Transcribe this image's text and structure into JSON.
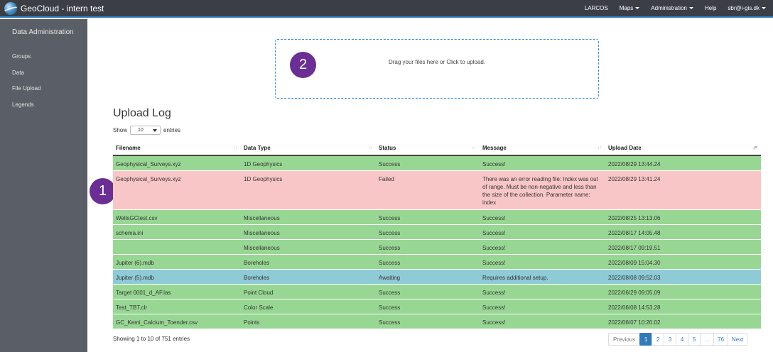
{
  "app": {
    "title": "GeoCloud - intern test"
  },
  "nav": {
    "items": [
      {
        "label": "LARCOS",
        "dropdown": false
      },
      {
        "label": "Maps",
        "dropdown": true
      },
      {
        "label": "Administration",
        "dropdown": true
      },
      {
        "label": "Help",
        "dropdown": false
      },
      {
        "label": "sbr@i-gis.dk",
        "dropdown": true
      }
    ]
  },
  "sidebar": {
    "title": "Data Administration",
    "items": [
      {
        "label": "Groups"
      },
      {
        "label": "Data"
      },
      {
        "label": "File Upload"
      },
      {
        "label": "Legends"
      }
    ]
  },
  "upload": {
    "dropzone_text": "Drag your files here or Click to upload."
  },
  "badges": {
    "one": "1",
    "two": "2"
  },
  "log": {
    "title": "Upload Log",
    "show_prefix": "Show",
    "show_value": "10",
    "show_suffix": "entries",
    "columns": [
      "Filename",
      "Data Type",
      "Status",
      "Message",
      "Upload Date"
    ],
    "rows": [
      {
        "filename": "Geophysical_Surveys.xyz",
        "data_type": "1D Geophysics",
        "status": "Success",
        "message": "Success!",
        "date": "2022/08/29 13:44.24",
        "state": "success"
      },
      {
        "filename": "Geophysical_Surveys.xyz",
        "data_type": "1D Geophysics",
        "status": "Failed",
        "message": "There was an error reading file: Index was out of range. Must be non-negative and less than the size of the collection. Parameter name: index",
        "date": "2022/08/29 13:41.24",
        "state": "failed"
      },
      {
        "filename": "WellsGCtest.csv",
        "data_type": "Miscellaneous",
        "status": "Success",
        "message": "Success!",
        "date": "2022/08/25 13:13.06",
        "state": "success"
      },
      {
        "filename": "schema.ini",
        "data_type": "Miscellaneous",
        "status": "Success",
        "message": "Success!",
        "date": "2022/08/17 14:05.48",
        "state": "success"
      },
      {
        "filename": "",
        "data_type": "Miscellaneous",
        "status": "Success",
        "message": "Success!",
        "date": "2022/08/17 09:19.51",
        "state": "success"
      },
      {
        "filename": "Jupiter (6).mdb",
        "data_type": "Boreholes",
        "status": "Success",
        "message": "Success!",
        "date": "2022/08/09 15:04.30",
        "state": "success"
      },
      {
        "filename": "Jupiter (5).mdb",
        "data_type": "Boreholes",
        "status": "Awaiting",
        "message": "Requires additional setup.",
        "date": "2022/08/08 09:52.03",
        "state": "awaiting"
      },
      {
        "filename": "Target 0001_d_AF.las",
        "data_type": "Point Cloud",
        "status": "Success",
        "message": "Success!",
        "date": "2022/06/29 09:05.09",
        "state": "success"
      },
      {
        "filename": "Test_TBT.clr",
        "data_type": "Color Scale",
        "status": "Success",
        "message": "Success!",
        "date": "2022/06/08 14:53.28",
        "state": "success"
      },
      {
        "filename": "GC_Kemi_Calcium_Toender.csv",
        "data_type": "Points",
        "status": "Success",
        "message": "Success!",
        "date": "2022/06/07 10:20.02",
        "state": "success"
      }
    ],
    "footer": "Showing 1 to 10 of 751 entries"
  },
  "pagination": {
    "previous": "Previous",
    "pages": [
      "1",
      "2",
      "3",
      "4",
      "5",
      "…",
      "76"
    ],
    "active": "1",
    "next": "Next"
  },
  "colors": {
    "success": "#98d793",
    "failed": "#f9c6c7",
    "awaiting": "#8fcbd7",
    "accent": "#337ab7",
    "badge": "#6a2e94"
  }
}
